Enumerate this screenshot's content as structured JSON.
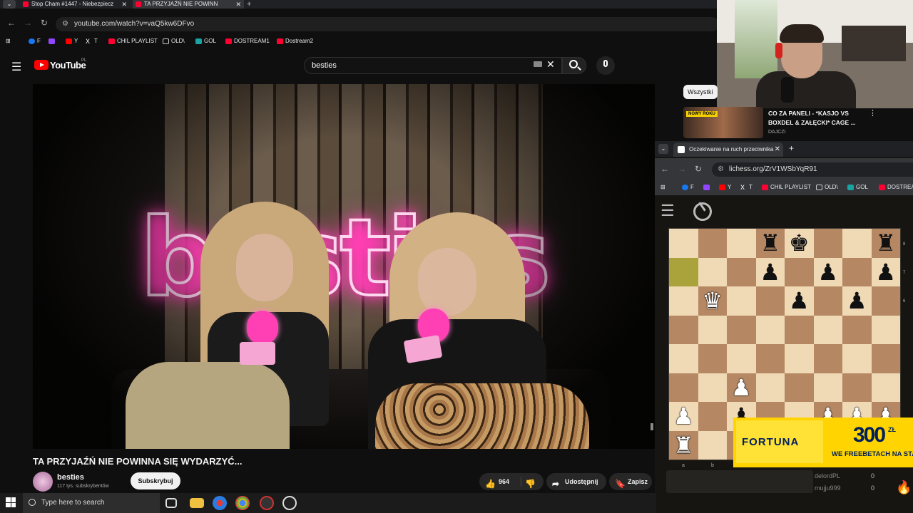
{
  "browser": {
    "tabs": [
      {
        "title": "Stop Cham #1447 - Niebezpiecz"
      },
      {
        "title": "TA PRZYJAŹŃ NIE POWINN"
      }
    ],
    "new_tab": "+",
    "tab_menu": "⌄",
    "url": "youtube.com/watch?v=vaQ5kw6DFvo",
    "bookmarks": [
      {
        "label": "F",
        "color": "#1877f2"
      },
      {
        "label": "",
        "color": "#9146ff"
      },
      {
        "label": "Y",
        "color": "#ff0000"
      },
      {
        "label": "T",
        "color": "#000000"
      },
      {
        "label": "CHIL PLAYLIST",
        "color": "#ff0033"
      },
      {
        "label": "OLD\\",
        "color": "#888888"
      },
      {
        "label": "GOL",
        "color": "#1aa3a3"
      },
      {
        "label": "DOSTREAM1",
        "color": "#ff0033"
      },
      {
        "label": "Dostream2",
        "color": "#ff0033"
      }
    ]
  },
  "youtube": {
    "logo_text": "YouTube",
    "logo_region": "PL",
    "search_value": "besties",
    "video": {
      "title": "TA PRZYJAŹŃ NIE POWINNA SIĘ WYDARZYĆ...",
      "neon_text": "besties"
    },
    "channel": {
      "name": "besties",
      "subscribers": "117 tys. subskrybentów",
      "subscribe_label": "Subskrybuj"
    },
    "actions": {
      "likes": "964",
      "share_label": "Udostępnij",
      "save_label": "Zapisz"
    },
    "filter_chip": "Wszystki",
    "recommendation": {
      "title": "CO ZA PANELI - *KASJO VS BOXDEL & ZAŁĘCKI* CAGE ...",
      "channel": "DAJCZI",
      "badge": "NOWY ROKU"
    }
  },
  "lichess": {
    "tab_title": "Oczekiwanie na ruch przeciwnika",
    "url": "lichess.org/ZrV1WSbYqR91",
    "bookmarks": [
      {
        "label": "F",
        "color": "#1877f2"
      },
      {
        "label": "",
        "color": "#9146ff"
      },
      {
        "label": "Y",
        "color": "#ff0000"
      },
      {
        "label": "T",
        "color": "#000000"
      },
      {
        "label": "CHIL PLAYLIST",
        "color": "#ff0033"
      },
      {
        "label": "OLD\\",
        "color": "#888888"
      },
      {
        "label": "GOL",
        "color": "#1aa3a3"
      },
      {
        "label": "DOSTREA",
        "color": "#ff0033"
      }
    ],
    "board": {
      "ranks": [
        [
          "",
          "",
          "",
          "br",
          "bk",
          "",
          "",
          "br"
        ],
        [
          "hl",
          "",
          "",
          "bp",
          "",
          "bp",
          "",
          "bp"
        ],
        [
          "",
          "wq",
          "",
          "",
          "bp",
          "",
          "bp",
          ""
        ],
        [
          "",
          "",
          "",
          "",
          "",
          "",
          "",
          ""
        ],
        [
          "",
          "",
          "",
          "",
          "",
          "",
          "",
          ""
        ],
        [
          "",
          "",
          "wp",
          "",
          "",
          "",
          "",
          ""
        ],
        [
          "wp",
          "",
          "bp",
          "",
          "",
          "wp",
          "wp",
          "wp"
        ],
        [
          "wr",
          "",
          "",
          "",
          "",
          "",
          "",
          ""
        ]
      ],
      "rank_labels": [
        "8",
        "7",
        "6"
      ],
      "file_labels": [
        "a",
        "b"
      ]
    },
    "players": [
      {
        "name": "delordPL",
        "score": "0"
      },
      {
        "name": "mujju999",
        "score": "0"
      }
    ]
  },
  "ad": {
    "brand": "FORTUNA",
    "amount": "300",
    "currency": "ZŁ",
    "subtitle": "WE FREEBETACH NA STA"
  },
  "taskbar": {
    "search_placeholder": "Type here to search"
  }
}
